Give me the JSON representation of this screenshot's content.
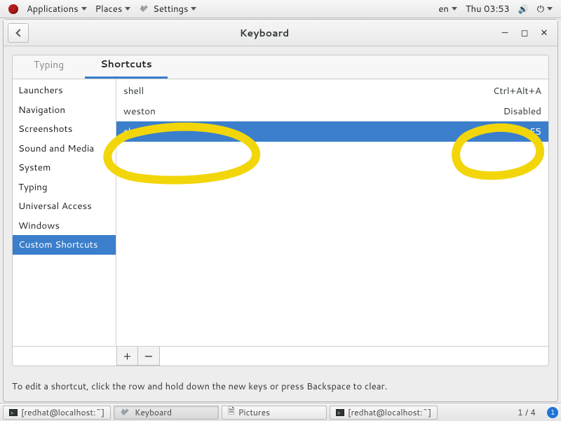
{
  "top_panel": {
    "applications": "Applications",
    "places": "Places",
    "settings": "Settings",
    "lang": "en",
    "clock": "Thu 03:53"
  },
  "window": {
    "title": "Keyboard"
  },
  "tabs": {
    "typing": "Typing",
    "shortcuts": "Shortcuts"
  },
  "categories": [
    "Launchers",
    "Navigation",
    "Screenshots",
    "Sound and Media",
    "System",
    "Typing",
    "Universal Access",
    "Windows",
    "Custom Shortcuts"
  ],
  "selected_category_index": 8,
  "shortcuts": [
    {
      "name": "shell",
      "accel": "Ctrl+Alt+A"
    },
    {
      "name": "weston",
      "accel": "Disabled"
    },
    {
      "name": "shell",
      "accel": "F5"
    }
  ],
  "selected_shortcut_index": 2,
  "buttons": {
    "add": "+",
    "remove": "−"
  },
  "hint": "To edit a shortcut, click the row and hold down the new keys or press Backspace to clear.",
  "taskbar": {
    "items": [
      "[redhat@localhost:~]",
      "Keyboard",
      "Pictures",
      "[redhat@localhost:~]"
    ],
    "workspace": "1 / 4",
    "badge": "1"
  }
}
